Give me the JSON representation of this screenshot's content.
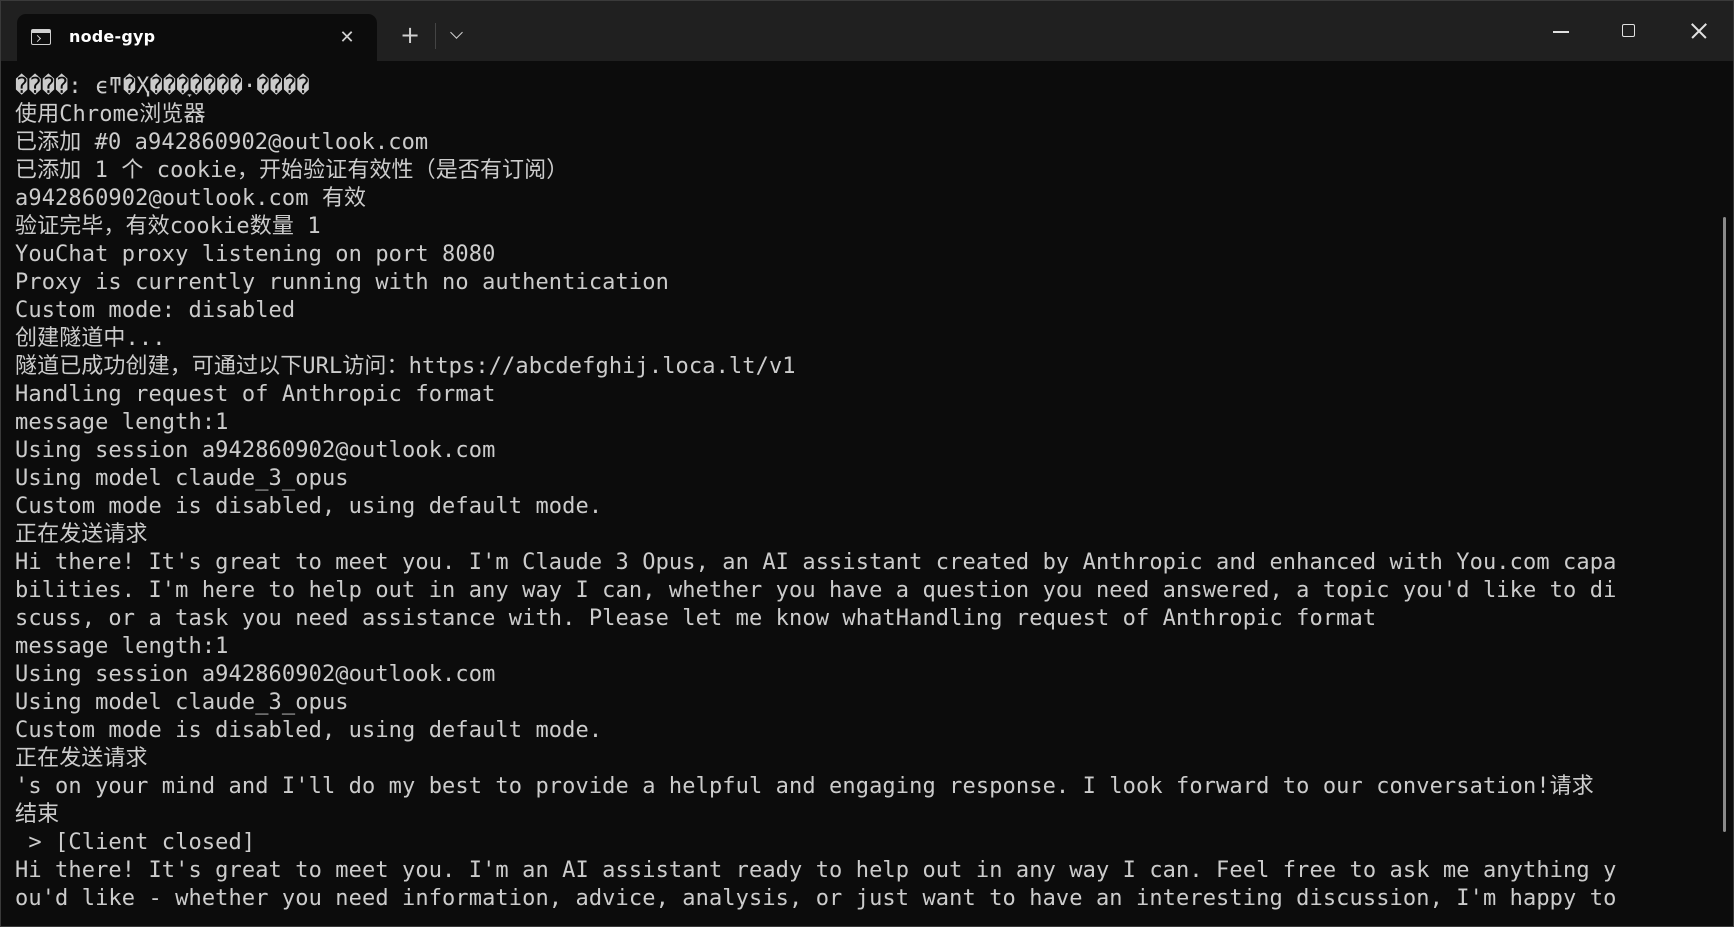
{
  "window": {
    "tab_title": "node-gyp",
    "tab_close_glyph": "✕",
    "new_tab_glyph": "+"
  },
  "terminal": {
    "lines": [
      "����: ϵͳ�Ҳ���ָ����·����",
      "使用Chrome浏览器",
      "已添加 #0 a942860902@outlook.com",
      "已添加 1 个 cookie，开始验证有效性（是否有订阅）",
      "a942860902@outlook.com 有效",
      "验证完毕，有效cookie数量 1",
      "YouChat proxy listening on port 8080",
      "Proxy is currently running with no authentication",
      "Custom mode: disabled",
      "创建隧道中...",
      "隧道已成功创建，可通过以下URL访问：https://abcdefghij.loca.lt/v1",
      "Handling request of Anthropic format",
      "message length:1",
      "Using session a942860902@outlook.com",
      "Using model claude_3_opus",
      "Custom mode is disabled, using default mode.",
      "正在发送请求",
      "Hi there! It's great to meet you. I'm Claude 3 Opus, an AI assistant created by Anthropic and enhanced with You.com capa",
      "bilities. I'm here to help out in any way I can, whether you have a question you need answered, a topic you'd like to di",
      "scuss, or a task you need assistance with. Please let me know whatHandling request of Anthropic format",
      "message length:1",
      "Using session a942860902@outlook.com",
      "Using model claude_3_opus",
      "Custom mode is disabled, using default mode.",
      "正在发送请求",
      "'s on your mind and I'll do my best to provide a helpful and engaging response. I look forward to our conversation!请求",
      "结束",
      " > [Client closed]",
      "Hi there! It's great to meet you. I'm an AI assistant ready to help out in any way I can. Feel free to ask me anything y",
      "ou'd like - whether you need information, advice, analysis, or just want to have an interesting discussion, I'm happy to"
    ]
  },
  "colors": {
    "terminal_bg": "#0c0c0c",
    "titlebar_bg": "#202020",
    "text": "#cccccc"
  }
}
